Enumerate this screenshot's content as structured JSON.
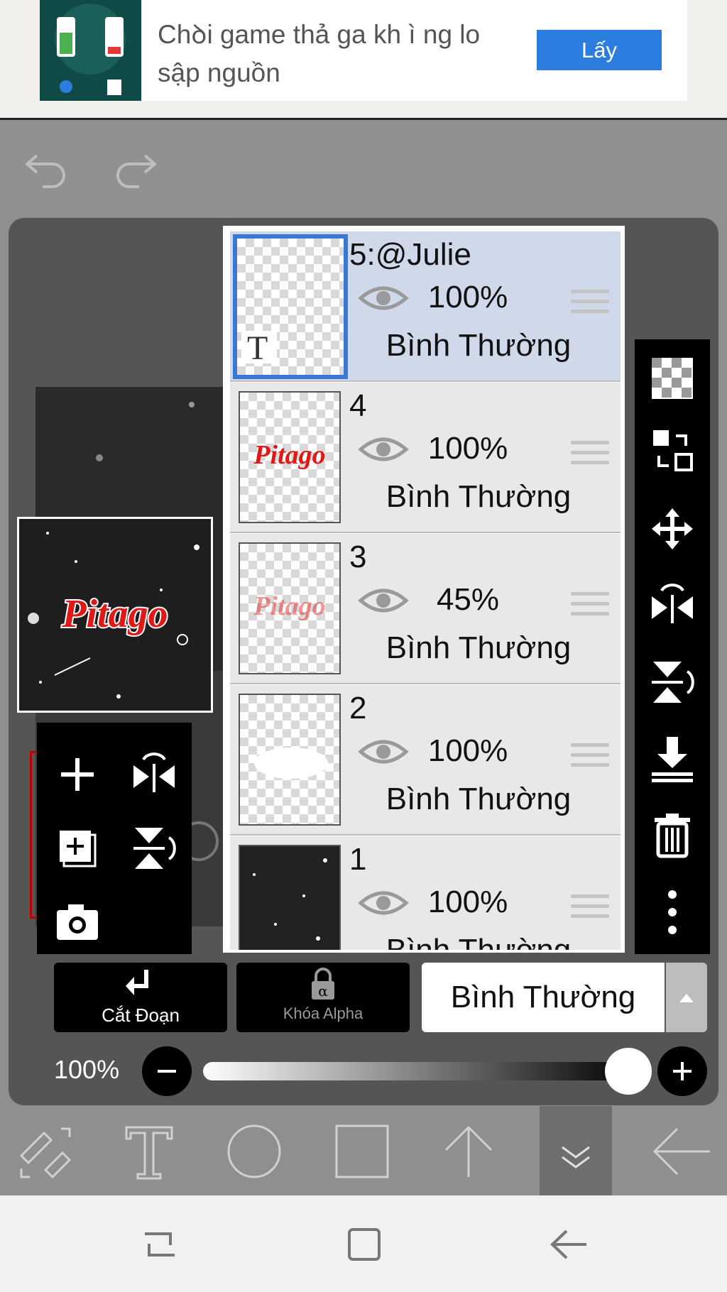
{
  "ad": {
    "text": "Chꝺi game thả ga kh ì ng lo sập nguồn",
    "button_label": "Lấy"
  },
  "layers": [
    {
      "name": "5:@Julie",
      "opacity": "100%",
      "blend": "Bình Thường",
      "selected": true,
      "thumb": "text-layer"
    },
    {
      "name": "4",
      "opacity": "100%",
      "blend": "Bình Thường",
      "thumb": "Pitago"
    },
    {
      "name": "3",
      "opacity": "45%",
      "blend": "Bình Thường",
      "thumb": "Pitago"
    },
    {
      "name": "2",
      "opacity": "100%",
      "blend": "Bình Thường",
      "thumb": "white-blob"
    },
    {
      "name": "1",
      "opacity": "100%",
      "blend": "Bình Thường",
      "thumb": "dark-starfield"
    }
  ],
  "preview": {
    "art_text": "Pitago"
  },
  "panel": {
    "cut_label": "Cắt Đoạn",
    "alpha_label": "Khóa Alpha",
    "blend_mode": "Bình Thường"
  },
  "opacity": {
    "label": "100%",
    "value": 1.0
  },
  "colors": {
    "selected_layer": "#cfd9ea",
    "selected_border": "#3a78d6",
    "ad_button": "#2b7de0"
  }
}
